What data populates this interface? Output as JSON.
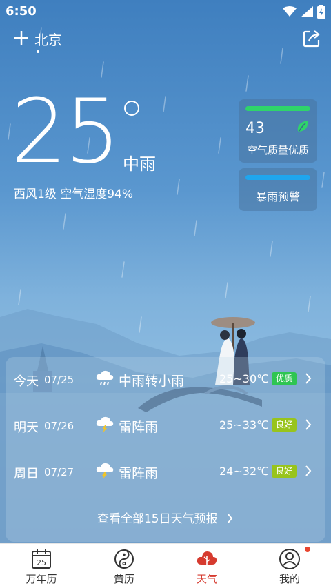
{
  "status_bar": {
    "time": "6:50"
  },
  "header": {
    "city": "北京"
  },
  "current": {
    "temperature": "25",
    "condition": "中雨",
    "wind_humidity": "西风1级   空气湿度94%"
  },
  "aqi": {
    "value": "43",
    "label": "空气质量优质",
    "color": "#2fd46a"
  },
  "warning": {
    "label": "暴雨预警",
    "color": "#1fa6ee"
  },
  "forecast": [
    {
      "day": "今天",
      "date": "07/25",
      "icon": "rain-cloud-icon",
      "desc": "中雨转小雨",
      "range": "25~30℃",
      "quality": "优质",
      "quality_color": "#2fc552"
    },
    {
      "day": "明天",
      "date": "07/26",
      "icon": "thunderstorm-icon",
      "desc": "雷阵雨",
      "range": "25~33℃",
      "quality": "良好",
      "quality_color": "#98c41c"
    },
    {
      "day": "周日",
      "date": "07/27",
      "icon": "thunderstorm-icon",
      "desc": "雷阵雨",
      "range": "24~32℃",
      "quality": "良好",
      "quality_color": "#98c41c"
    }
  ],
  "forecast_more": "查看全部15日天气预报",
  "tabs": [
    {
      "label": "万年历",
      "icon": "calendar-icon",
      "badge": "25"
    },
    {
      "label": "黄历",
      "icon": "yin-yang-icon"
    },
    {
      "label": "天气",
      "icon": "weather-icon",
      "active": true
    },
    {
      "label": "我的",
      "icon": "profile-icon"
    }
  ]
}
